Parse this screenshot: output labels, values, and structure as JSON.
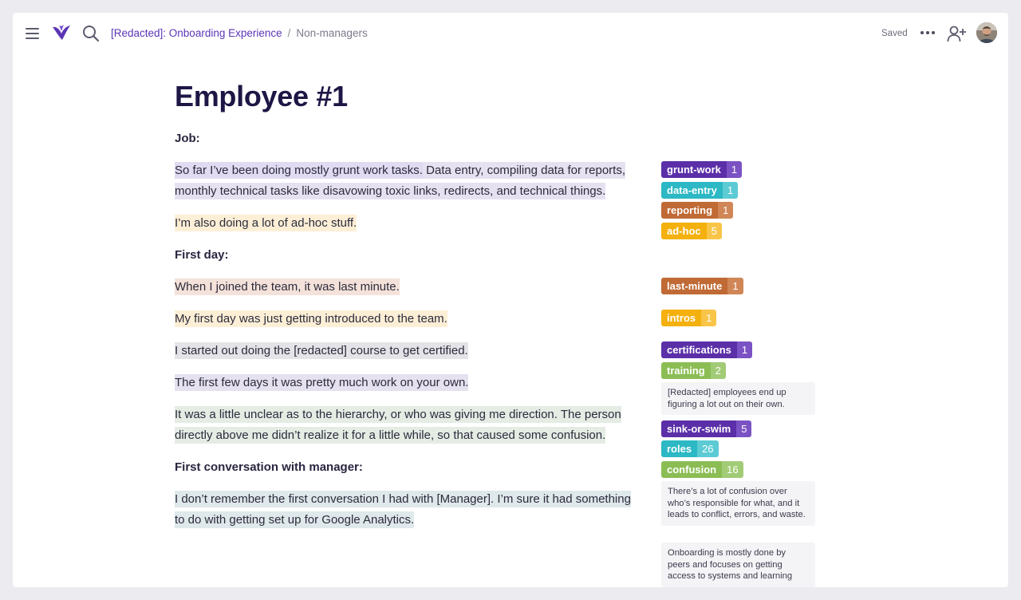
{
  "topbar": {
    "breadcrumb": {
      "project": "[Redacted]: Onboarding Experience",
      "separator": "/",
      "current": "Non-managers"
    },
    "status": "Saved",
    "icons": [
      "menu-icon",
      "logo-icon",
      "search-icon",
      "more-icon",
      "add-user-icon",
      "avatar"
    ]
  },
  "document": {
    "title": "Employee #1",
    "headings": {
      "job": "Job:",
      "first_day": "First day:",
      "first_conversation": "First conversation with manager:"
    },
    "paragraphs": [
      {
        "segments": [
          {
            "text": "So far I’ve been doing mostly grunt work tasks.",
            "color": "#e1dbf2"
          },
          {
            "text": " Data entry, compiling data for reports, monthly technical tasks like disavowing toxic links, redirects, and technical things.",
            "color": "#e6e1f1"
          }
        ]
      },
      {
        "segments": [
          {
            "text": "I’m also doing a lot of ad-hoc stuff.",
            "color": "#fdefd6"
          }
        ]
      },
      {
        "segments": [
          {
            "text": "When I joined the team, it was last minute.",
            "color": "#f4e2da"
          }
        ]
      },
      {
        "segments": [
          {
            "text": "My first day was just getting introduced to the team.",
            "color": "#fdefd6"
          }
        ]
      },
      {
        "segments": [
          {
            "text": "I started out doing the [redacted] course to get certified.",
            "color": "#e4e4e8"
          }
        ]
      },
      {
        "segments": [
          {
            "text": "The first few days it was pretty much work on your own.",
            "color": "#e5e1ef"
          }
        ]
      },
      {
        "segments": [
          {
            "text": "It was a little unclear as to the hierarchy, or who was giving me direction. The person directly above me didn’t realize it for a little while, so that caused some confusion.",
            "color": "#e4ece4"
          }
        ]
      },
      {
        "segments": [
          {
            "text": "I don’t remember the first conversation I had with [Manager]. I’m sure it had something to do with getting set up for Google Analytics.",
            "color": "#dfe8ea"
          }
        ]
      }
    ]
  },
  "tags": [
    {
      "name": "grunt-work",
      "count": "1",
      "color": "#5b2fa8",
      "count_color": "#7b52c4"
    },
    {
      "name": "data-entry",
      "count": "1",
      "color": "#2cb8c4",
      "count_color": "#5ccbd4"
    },
    {
      "name": "reporting",
      "count": "1",
      "color": "#c06a35",
      "count_color": "#d08656"
    },
    {
      "name": "ad-hoc",
      "count": "5",
      "color": "#f4b00c",
      "count_color": "#f8c548"
    },
    {
      "name": "last-minute",
      "count": "1",
      "color": "#c06a35",
      "count_color": "#d08656"
    },
    {
      "name": "intros",
      "count": "1",
      "color": "#f4b00c",
      "count_color": "#f8c548"
    },
    {
      "name": "certifications",
      "count": "1",
      "color": "#5b2fa8",
      "count_color": "#7b52c4"
    },
    {
      "name": "training",
      "count": "2",
      "color": "#8bbd54",
      "count_color": "#a2cb76"
    },
    {
      "name": "sink-or-swim",
      "count": "5",
      "color": "#5b2fa8",
      "count_color": "#7b52c4"
    },
    {
      "name": "roles",
      "count": "26",
      "color": "#2cb8c4",
      "count_color": "#5ccbd4"
    },
    {
      "name": "confusion",
      "count": "16",
      "color": "#8bbd54",
      "count_color": "#a2cb76"
    }
  ],
  "notes": [
    "[Redacted] employees end up figuring a lot out on their own.",
    "There’s a lot of confusion over who’s responsible for what, and it leads to conflict, errors, and waste.",
    "Onboarding is mostly done by peers and focuses on getting access to systems and learning"
  ]
}
